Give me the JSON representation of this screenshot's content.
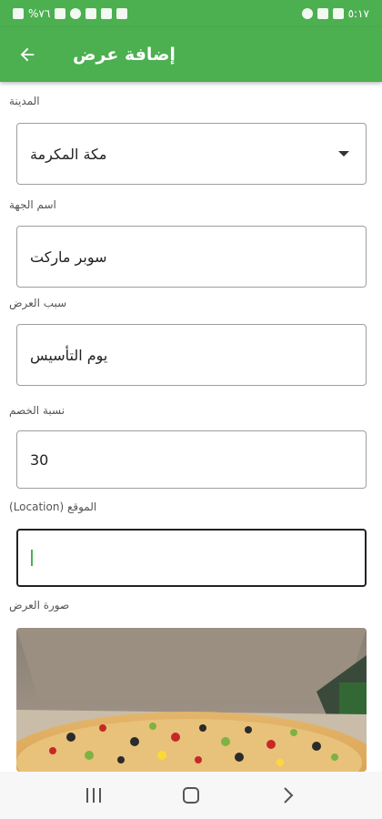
{
  "status_bar": {
    "left_text": "%٧٦",
    "time": "٥:١٧"
  },
  "app_bar": {
    "title": "إضافة عرض"
  },
  "form": {
    "city": {
      "label": "المدينة",
      "value": "مكة المكرمة"
    },
    "entity_name": {
      "label": "اسم الجهة",
      "value": "سوبر ماركت"
    },
    "offer_reason": {
      "label": "سبب العرض",
      "value": "يوم التأسيس"
    },
    "discount": {
      "label": "نسبة الخصم",
      "value": "30"
    },
    "location": {
      "label": "الموقع (Location)",
      "value": ""
    },
    "offer_image": {
      "label": "صورة العرض"
    }
  },
  "colors": {
    "primary": "#4caf50",
    "cursor": "#4caf50"
  }
}
